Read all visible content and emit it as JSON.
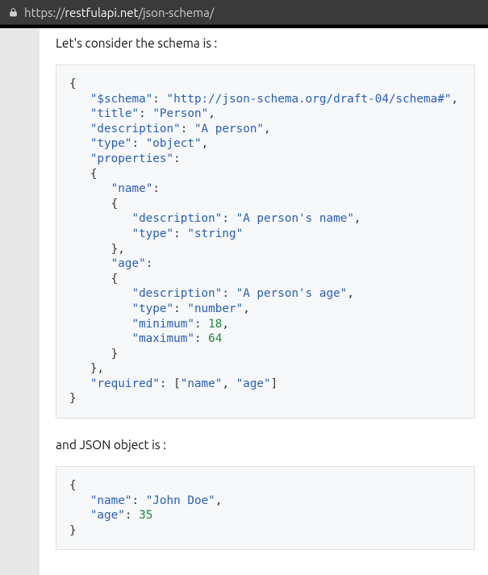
{
  "browser": {
    "url_scheme": "https://",
    "url_host": "restfulapi.net",
    "url_path": "/json-schema/"
  },
  "page": {
    "intro1": "Let's consider the schema is :",
    "intro2": "and JSON object is :"
  },
  "schema_block": {
    "tokens": [
      {
        "ind": 0,
        "t": "{",
        "c": "punc"
      },
      {
        "ind": 1,
        "t": "\"$schema\"",
        "c": "key"
      },
      {
        "t": ": ",
        "c": "punc"
      },
      {
        "t": "\"http://json-schema.org/draft-04/schema#\"",
        "c": "str"
      },
      {
        "t": ",",
        "c": "punc"
      },
      {
        "ind": 1,
        "t": "\"title\"",
        "c": "key"
      },
      {
        "t": ": ",
        "c": "punc"
      },
      {
        "t": "\"Person\"",
        "c": "str"
      },
      {
        "t": ",",
        "c": "punc"
      },
      {
        "ind": 1,
        "t": "\"description\"",
        "c": "key"
      },
      {
        "t": ": ",
        "c": "punc"
      },
      {
        "t": "\"A person\"",
        "c": "str"
      },
      {
        "t": ",",
        "c": "punc"
      },
      {
        "ind": 1,
        "t": "\"type\"",
        "c": "key"
      },
      {
        "t": ": ",
        "c": "punc"
      },
      {
        "t": "\"object\"",
        "c": "str"
      },
      {
        "t": ",",
        "c": "punc"
      },
      {
        "ind": 1,
        "t": "\"properties\"",
        "c": "key"
      },
      {
        "t": ":",
        "c": "punc"
      },
      {
        "ind": 1,
        "t": "{",
        "c": "punc"
      },
      {
        "ind": 2,
        "t": "\"name\"",
        "c": "key"
      },
      {
        "t": ":",
        "c": "punc"
      },
      {
        "ind": 2,
        "t": "{",
        "c": "punc"
      },
      {
        "ind": 3,
        "t": "\"description\"",
        "c": "key"
      },
      {
        "t": ": ",
        "c": "punc"
      },
      {
        "t": "\"A person's name\"",
        "c": "str"
      },
      {
        "t": ",",
        "c": "punc"
      },
      {
        "ind": 3,
        "t": "\"type\"",
        "c": "key"
      },
      {
        "t": ": ",
        "c": "punc"
      },
      {
        "t": "\"string\"",
        "c": "str"
      },
      {
        "ind": 2,
        "t": "},",
        "c": "punc"
      },
      {
        "ind": 2,
        "t": "\"age\"",
        "c": "key"
      },
      {
        "t": ":",
        "c": "punc"
      },
      {
        "ind": 2,
        "t": "{",
        "c": "punc"
      },
      {
        "ind": 3,
        "t": "\"description\"",
        "c": "key"
      },
      {
        "t": ": ",
        "c": "punc"
      },
      {
        "t": "\"A person's age\"",
        "c": "str"
      },
      {
        "t": ",",
        "c": "punc"
      },
      {
        "ind": 3,
        "t": "\"type\"",
        "c": "key"
      },
      {
        "t": ": ",
        "c": "punc"
      },
      {
        "t": "\"number\"",
        "c": "str"
      },
      {
        "t": ",",
        "c": "punc"
      },
      {
        "ind": 3,
        "t": "\"minimum\"",
        "c": "key"
      },
      {
        "t": ": ",
        "c": "punc"
      },
      {
        "t": "18",
        "c": "num"
      },
      {
        "t": ",",
        "c": "punc"
      },
      {
        "ind": 3,
        "t": "\"maximum\"",
        "c": "key"
      },
      {
        "t": ": ",
        "c": "punc"
      },
      {
        "t": "64",
        "c": "num"
      },
      {
        "ind": 2,
        "t": "}",
        "c": "punc"
      },
      {
        "ind": 1,
        "t": "},",
        "c": "punc"
      },
      {
        "ind": 1,
        "t": "\"required\"",
        "c": "key"
      },
      {
        "t": ": [",
        "c": "punc"
      },
      {
        "t": "\"name\"",
        "c": "str"
      },
      {
        "t": ", ",
        "c": "punc"
      },
      {
        "t": "\"age\"",
        "c": "str"
      },
      {
        "t": "]",
        "c": "punc"
      },
      {
        "ind": 0,
        "t": "}",
        "c": "punc"
      }
    ]
  },
  "json_block": {
    "tokens": [
      {
        "ind": 0,
        "t": "{",
        "c": "punc"
      },
      {
        "ind": 1,
        "t": "\"name\"",
        "c": "key"
      },
      {
        "t": ": ",
        "c": "punc"
      },
      {
        "t": "\"John Doe\"",
        "c": "str"
      },
      {
        "t": ",",
        "c": "punc"
      },
      {
        "ind": 1,
        "t": "\"age\"",
        "c": "key"
      },
      {
        "t": ": ",
        "c": "punc"
      },
      {
        "t": "35",
        "c": "num"
      },
      {
        "ind": 0,
        "t": "}",
        "c": "punc"
      }
    ]
  }
}
